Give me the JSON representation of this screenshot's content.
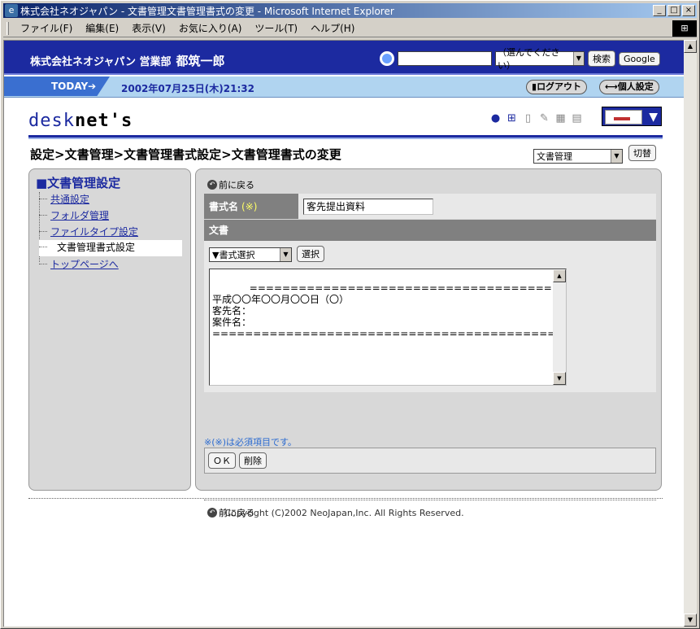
{
  "window": {
    "title": "株式会社ネオジャパン - 文書管理文書管理書式の変更 - Microsoft Internet Explorer",
    "controls": [
      "_",
      "□",
      "×"
    ]
  },
  "menu": [
    "ファイル(F)",
    "編集(E)",
    "表示(V)",
    "お気に入り(A)",
    "ツール(T)",
    "ヘルプ(H)"
  ],
  "header": {
    "company": "株式会社ネオジャパン 営業部",
    "user": "都筑一郎",
    "search_select": "（選んでください）",
    "search_button": "検索",
    "google_button": "Google",
    "today_label": "TODAY➔",
    "date": "2002年07月25日(木)21:32",
    "logout": "ログアウト",
    "personal": "個人設定"
  },
  "logo": {
    "part1": "desk",
    "part2": "net's"
  },
  "breadcrumb": "設定>文書管理>文書管理書式設定>文書管理書式の変更",
  "doc_select": "文書管理",
  "switch_button": "切替",
  "sidebar": {
    "title": "■文書管理設定",
    "items": [
      "共通設定",
      "フォルダ管理",
      "ファイルタイプ設定",
      "文書管理書式設定",
      "トップページへ"
    ]
  },
  "content": {
    "back": "前に戻る",
    "name_label": "書式名",
    "required_mark": "(※)",
    "name_value": "客先提出資料",
    "doc_label": "文書",
    "format_select": "▼書式選択",
    "select_button": "選択",
    "body_text": "==========================================\n平成〇〇年〇〇月〇〇日（〇）\n客先名：\n案件名：\n==========================================",
    "note": "※(※)は必須項目です。",
    "ok_button": "ＯＫ",
    "delete_button": "削除"
  },
  "copyright": "Copyright (C)2002 NeoJapan,Inc. All Rights Reserved."
}
